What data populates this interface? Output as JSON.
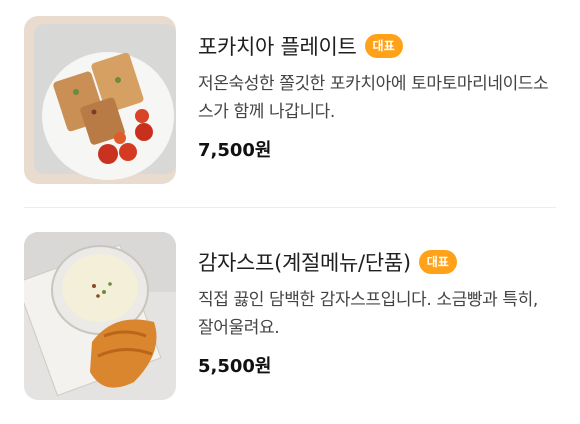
{
  "items": [
    {
      "name": "포카치아 플레이트",
      "badge": "대표",
      "description": "저온숙성한 쫄깃한 포카치아에 토마토마리네이드소스가 함께 나갑니다.",
      "price": "7,500원",
      "image_icon": "focaccia-plate-photo"
    },
    {
      "name": "감자스프(계절메뉴/단품)",
      "badge": "대표",
      "description": "직접 끓인 담백한 감자스프입니다. 소금빵과 특히, 잘어울려요.",
      "price": "5,500원",
      "image_icon": "potato-soup-photo"
    }
  ],
  "colors": {
    "badge": "#ffa21a",
    "divider": "#ececec"
  }
}
